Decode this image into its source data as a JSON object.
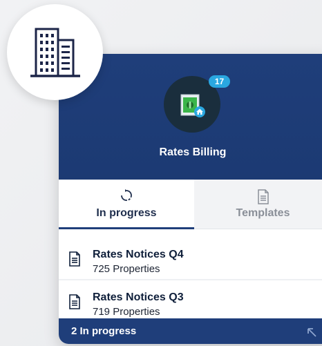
{
  "app": {
    "title": "Rates Billing",
    "badge_count": "17",
    "icon": "money-house-icon"
  },
  "tabs": [
    {
      "label": "In progress",
      "icon": "refresh-icon",
      "active": true
    },
    {
      "label": "Templates",
      "icon": "document-icon",
      "active": false
    }
  ],
  "items": [
    {
      "name": "Rates Notices Q4",
      "properties": "725 Properties",
      "icon": "document-icon"
    },
    {
      "name": "Rates Notices Q3",
      "properties": "719 Properties",
      "icon": "document-icon"
    }
  ],
  "footer": {
    "label": "2 In progress",
    "icon": "expand-arrow-icon"
  },
  "colors": {
    "header_bg": "#1f3e7a",
    "badge": "#2aa7e0",
    "circle_dark": "#1a2e3d",
    "money_green": "#3bb54a"
  },
  "building_icon": "office-building-icon"
}
